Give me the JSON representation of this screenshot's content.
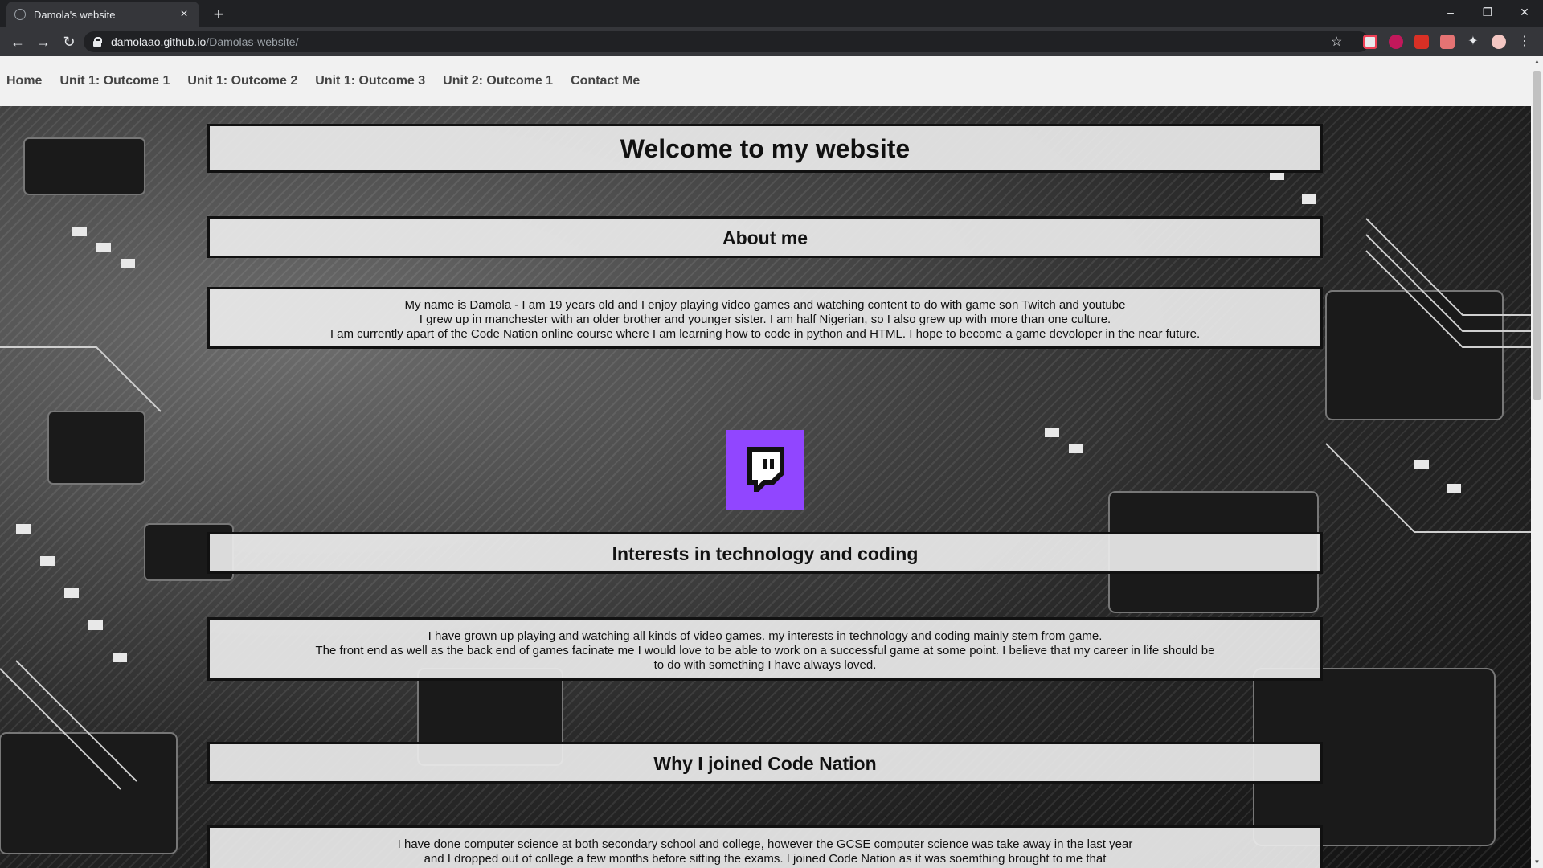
{
  "browser": {
    "tab_title": "Damola's website",
    "url_host": "damolaao.github.io",
    "url_path": "/Damolas-website/"
  },
  "nav": {
    "items": [
      {
        "label": "Home"
      },
      {
        "label": "Unit 1: Outcome 1"
      },
      {
        "label": "Unit 1: Outcome 2"
      },
      {
        "label": "Unit 1: Outcome 3"
      },
      {
        "label": "Unit 2: Outcome 1"
      },
      {
        "label": "Contact Me"
      }
    ]
  },
  "page": {
    "title": "Welcome to my website",
    "about_heading": "About me",
    "about_lines": [
      "My name is Damola - I am 19 years old and I enjoy playing video games and watching content to do with game son Twitch and youtube",
      "I grew up in manchester with an older brother and younger sister. I am half Nigerian, so I also grew up with more than one culture.",
      "I am currently apart of the Code Nation online course where I am learning how to code in python and HTML. I hope to become a game devoloper in the near future."
    ],
    "interests_heading": "Interests in technology and coding",
    "interests_lines": [
      "I have grown up playing and watching all kinds of video games. my interests in technology and coding mainly stem from game.",
      "The front end as well as the back end of games facinate me I would love to be able to work on a successful game at some point. I believe that my career in life should be",
      "to do with something I have always loved."
    ],
    "codenation_heading": "Why I joined Code Nation",
    "codenation_lines": [
      "I have done computer science at both secondary school and college, however the GCSE computer science was take away in the last year",
      "and I dropped out of college a few months before sitting the exams. I joined Code Nation as it was soemthing brought to me that"
    ]
  },
  "colors": {
    "twitch": "#9146ff",
    "box_bg": "#ececec"
  }
}
